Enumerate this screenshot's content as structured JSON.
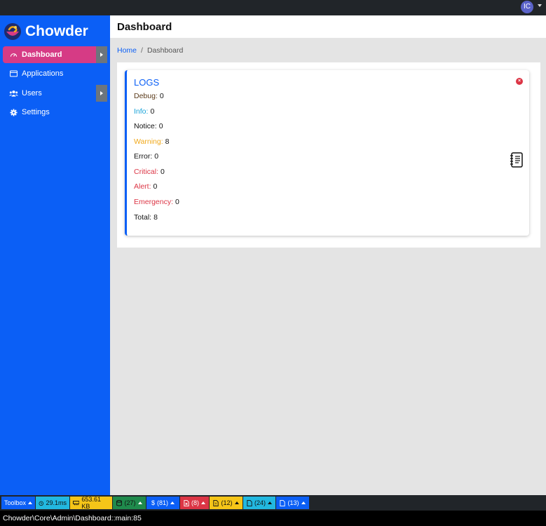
{
  "user": {
    "initials": "IC"
  },
  "brand": {
    "name": "Chowder"
  },
  "sidebar": {
    "items": [
      {
        "label": "Dashboard",
        "icon": "gauge-icon",
        "active": true,
        "expandable": true
      },
      {
        "label": "Applications",
        "icon": "window-icon",
        "active": false,
        "expandable": false
      },
      {
        "label": "Users",
        "icon": "users-icon",
        "active": false,
        "expandable": true
      },
      {
        "label": "Settings",
        "icon": "gear-icon",
        "active": false,
        "expandable": false
      }
    ]
  },
  "header": {
    "title": "Dashboard"
  },
  "breadcrumb": {
    "home": "Home",
    "separator": "/",
    "current": "Dashboard"
  },
  "logs": {
    "title": "LOGS",
    "rows": [
      {
        "label": "Debug:",
        "value": "0"
      },
      {
        "label": "Info:",
        "value": "0"
      },
      {
        "label": "Notice:",
        "value": "0"
      },
      {
        "label": "Warning:",
        "value": "8"
      },
      {
        "label": "Error:",
        "value": "0"
      },
      {
        "label": "Critical:",
        "value": "0"
      },
      {
        "label": "Alert:",
        "value": "0"
      },
      {
        "label": "Emergency:",
        "value": "0"
      },
      {
        "label": "Total:",
        "value": "8"
      }
    ]
  },
  "toolbox": {
    "label": "Toolbox",
    "time": "29.1ms",
    "memory": "653.61 KB",
    "database": "(27)",
    "variables": "(81)",
    "errors": "(8)",
    "warnings": "(12)",
    "files": "(24)",
    "includes": "(13)"
  },
  "status": {
    "route": "Chowder\\Core\\Admin\\Dashboard::main:85"
  },
  "colors": {
    "sidebar": "#0b5ff6",
    "active": "#d63b85",
    "accent": "#0b5ff6"
  }
}
